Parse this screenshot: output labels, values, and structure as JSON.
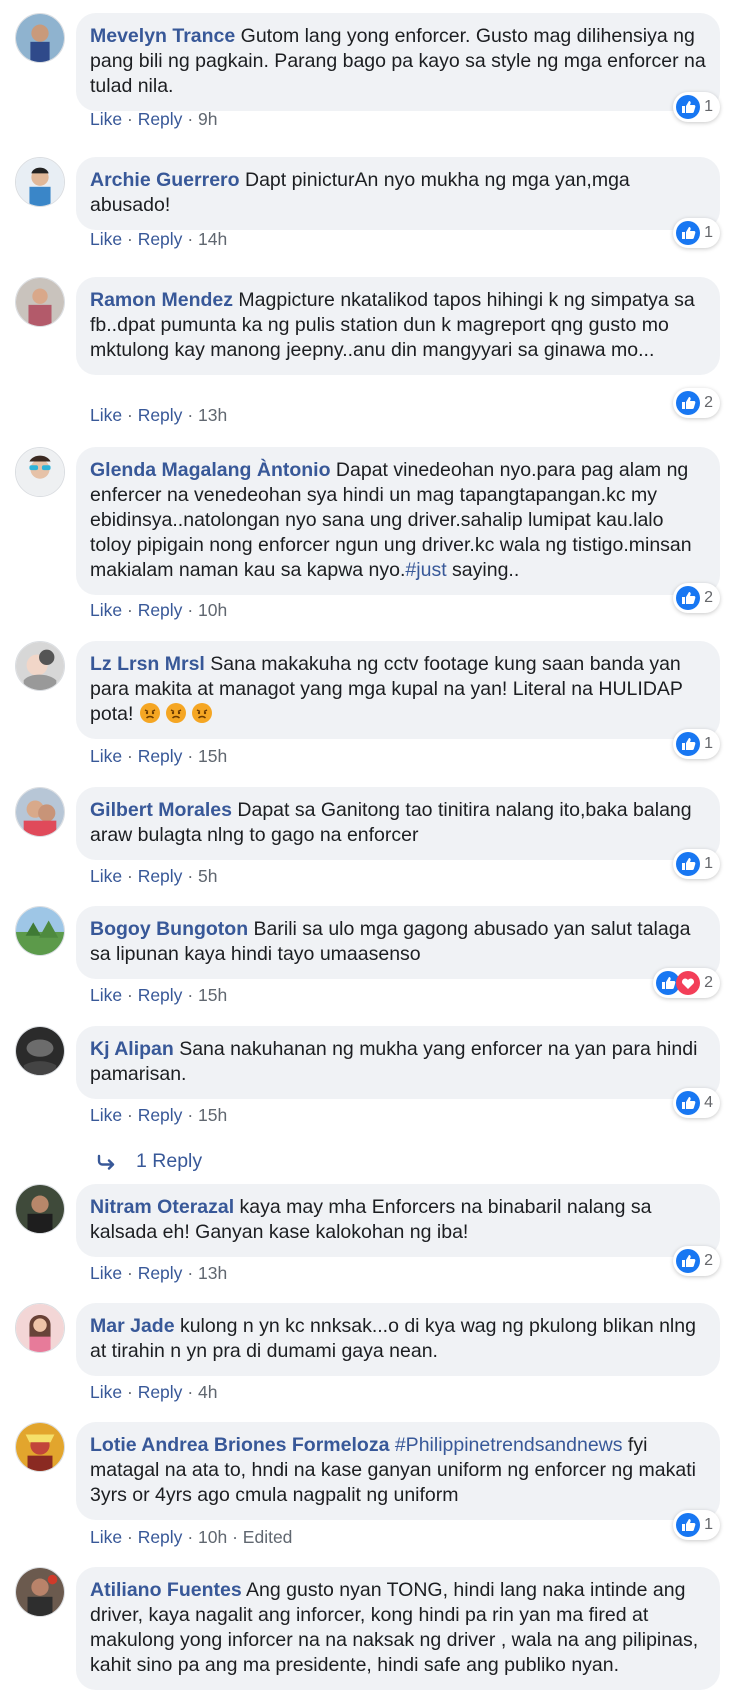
{
  "comments": [
    {
      "author": "Mevelyn Trance",
      "text": " Gutom lang yong enforcer. Gusto mag dilihensiya ng pang bili ng pagkain. Parang bago pa kayo sa style ng mga enforcer na tulad nila.",
      "like": "Like",
      "reply": "Reply",
      "time": "9h",
      "reaction_count": "1"
    },
    {
      "author": "Archie Guerrero",
      "text": " Dapt pinicturAn nyo mukha ng mga yan,mga abusado!",
      "like": "Like",
      "reply": "Reply",
      "time": "14h",
      "reaction_count": "1"
    },
    {
      "author": "Ramon Mendez",
      "text": " Magpicture nkatalikod tapos hihingi k ng simpatya sa fb..dpat pumunta ka ng pulis station dun k magreport qng gusto mo mktulong kay manong jeepny..anu din mangyyari sa ginawa mo...",
      "like": "Like",
      "reply": "Reply",
      "time": "13h",
      "reaction_count": "2"
    },
    {
      "author": "Glenda Magalang Àntonio",
      "text": " Dapat vinedeohan nyo.para pag alam ng enfercer na venedeohan sya hindi un mag tapangtapangan.kc my ebidinsya..natolongan nyo sana ung driver.sahalip lumipat kau.lalo toloy pipigain nong enforcer ngun ung driver.kc wala ng tistigo.minsan makialam naman kau sa kapwa nyo.",
      "hashtag": "#just",
      "text_after": " saying..",
      "like": "Like",
      "reply": "Reply",
      "time": "10h",
      "reaction_count": "2"
    },
    {
      "author": "Lz Lrsn Mrsl",
      "text": " Sana makakuha ng cctv footage kung saan banda yan para makita at managot yang mga kupal na yan! Literal na HULIDAP pota! ",
      "emoji_name": "angry-face",
      "like": "Like",
      "reply": "Reply",
      "time": "15h",
      "reaction_count": "1"
    },
    {
      "author": "Gilbert Morales",
      "text": " Dapat sa Ganitong tao tinitira nalang ito,baka balang araw bulagta nlng to gago na enforcer",
      "like": "Like",
      "reply": "Reply",
      "time": "5h",
      "reaction_count": "1"
    },
    {
      "author": "Bogoy Bungoton",
      "text": " Barili sa ulo mga gagong abusado yan salut talaga sa lipunan kaya hindi tayo umaasenso",
      "like": "Like",
      "reply": "Reply",
      "time": "15h",
      "reaction_count": "2"
    },
    {
      "author": "Kj Alipan",
      "text": " Sana nakuhanan ng mukha yang enforcer na yan para hindi pamarisan.",
      "like": "Like",
      "reply": "Reply",
      "time": "15h",
      "reaction_count": "4"
    },
    {
      "author": "Nitram Oterazal",
      "text": " kaya may mha Enforcers na binabaril nalang sa kalsada eh! Ganyan kase kalokohan ng iba!",
      "like": "Like",
      "reply": "Reply",
      "time": "13h",
      "reaction_count": "2"
    },
    {
      "author": "Mar Jade",
      "text": " kulong n yn kc nnksak...o di kya wag ng pkulong blikan nlng at tirahin n yn pra di dumami gaya nean.",
      "like": "Like",
      "reply": "Reply",
      "time": "4h"
    },
    {
      "author": "Lotie Andrea Briones Formeloza",
      "hashtag": " #Philippinetrendsandnews",
      "text": " fyi matagal na ata to, hndi na kase ganyan uniform ng enforcer ng makati 3yrs or 4yrs ago cmula nagpalit ng uniform",
      "like": "Like",
      "reply": "Reply",
      "time": "10h",
      "edited": "Edited",
      "reaction_count": "1"
    },
    {
      "author": "Atiliano Fuentes",
      "text": " Ang gusto nyan TONG, hindi lang naka intinde ang driver, kaya nagalit ang inforcer, kong hindi pa rin yan ma fired at makulong yong inforcer na na naksak ng driver , wala na ang pilipinas, kahit sino pa ang ma presidente, hindi safe ang publiko nyan."
    }
  ],
  "replies_link": {
    "label": "1 Reply"
  },
  "separator": "·",
  "colors": {
    "link": "#385898",
    "bubble": "#f0f2f5",
    "meta": "#606770",
    "like_blue": "#1877f2",
    "love_red": "#f33e58"
  },
  "icons": {
    "like": "like-icon",
    "love": "love-icon",
    "reply_arrow": "reply-arrow-icon"
  }
}
